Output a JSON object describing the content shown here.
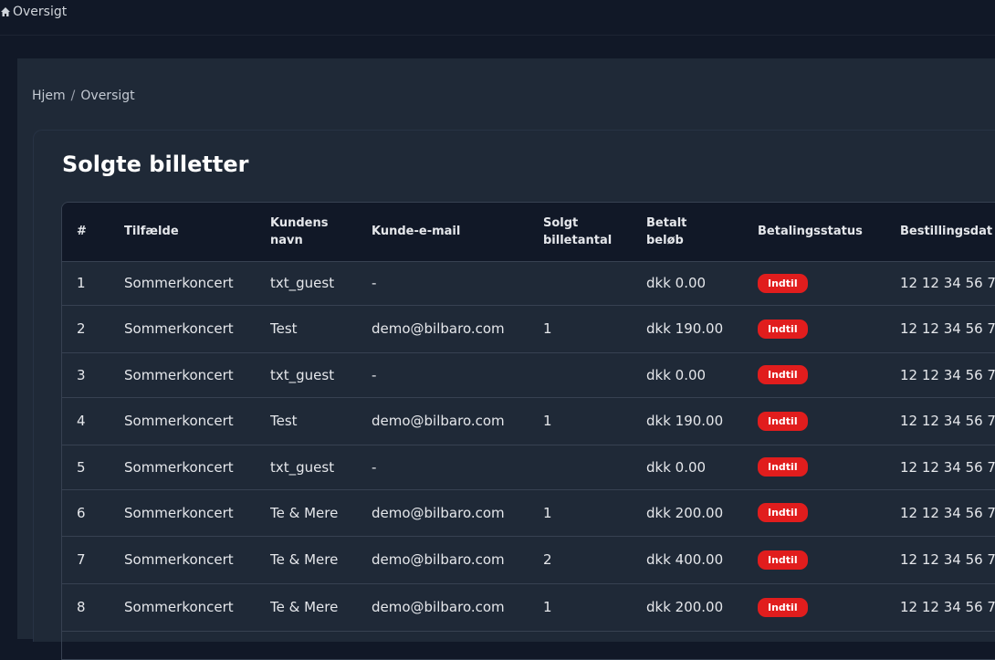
{
  "topbar": {
    "label": "Oversigt"
  },
  "breadcrumb": {
    "home": "Hjem",
    "separator": "/",
    "current": "Oversigt"
  },
  "page": {
    "title": "Solgte billetter"
  },
  "colors": {
    "background": "#111827",
    "panel": "#1f2937",
    "status_badge": "#e11d1d"
  },
  "table": {
    "headers": [
      "#",
      "Tilfælde",
      "Kundens navn",
      "Kunde-e-mail",
      "Solgt billetantal",
      "Betalt beløb",
      "Betalingsstatus",
      "Bestillingsdat"
    ],
    "rows": [
      {
        "n": "1",
        "event": "Sommerkoncert",
        "name": "txt_guest",
        "email": "-",
        "qty": "",
        "amount": "dkk 0.00",
        "status": "Indtil",
        "date": "12 12 34 56 7"
      },
      {
        "n": "2",
        "event": "Sommerkoncert",
        "name": "Test",
        "email": "demo@bilbaro.com",
        "qty": "1",
        "amount": "dkk 190.00",
        "status": "Indtil",
        "date": "12 12 34 56 7"
      },
      {
        "n": "3",
        "event": "Sommerkoncert",
        "name": "txt_guest",
        "email": "-",
        "qty": "",
        "amount": "dkk 0.00",
        "status": "Indtil",
        "date": "12 12 34 56 7"
      },
      {
        "n": "4",
        "event": "Sommerkoncert",
        "name": "Test",
        "email": "demo@bilbaro.com",
        "qty": "1",
        "amount": "dkk 190.00",
        "status": "Indtil",
        "date": "12 12 34 56 7"
      },
      {
        "n": "5",
        "event": "Sommerkoncert",
        "name": "txt_guest",
        "email": "-",
        "qty": "",
        "amount": "dkk 0.00",
        "status": "Indtil",
        "date": "12 12 34 56 7"
      },
      {
        "n": "6",
        "event": "Sommerkoncert",
        "name": "Te & Mere",
        "email": "demo@bilbaro.com",
        "qty": "1",
        "amount": "dkk 200.00",
        "status": "Indtil",
        "date": "12 12 34 56 7"
      },
      {
        "n": "7",
        "event": "Sommerkoncert",
        "name": "Te & Mere",
        "email": "demo@bilbaro.com",
        "qty": "2",
        "amount": "dkk 400.00",
        "status": "Indtil",
        "date": "12 12 34 56 7"
      },
      {
        "n": "8",
        "event": "Sommerkoncert",
        "name": "Te & Mere",
        "email": "demo@bilbaro.com",
        "qty": "1",
        "amount": "dkk 200.00",
        "status": "Indtil",
        "date": "12 12 34 56 7"
      },
      {
        "n": "",
        "event": "",
        "name": "",
        "email": "",
        "qty": "",
        "amount": "",
        "status": "",
        "date": ""
      }
    ]
  }
}
